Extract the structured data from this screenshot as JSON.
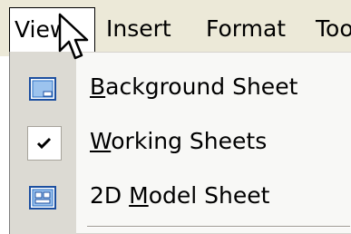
{
  "menubar": {
    "items": [
      {
        "label": "View"
      },
      {
        "label": "Insert"
      },
      {
        "label": "Format"
      },
      {
        "label": "Too"
      }
    ]
  },
  "dropdown": {
    "items": [
      {
        "pre": "",
        "ul": "B",
        "post": "ackground Sheet",
        "icon": "background-sheet-icon"
      },
      {
        "pre": "",
        "ul": "W",
        "post": "orking Sheets",
        "icon": "check-icon",
        "checked": true
      },
      {
        "pre": "2D ",
        "ul": "M",
        "post": "odel Sheet",
        "icon": "model-sheet-icon"
      }
    ]
  },
  "colors": {
    "menubar_bg": "#ece9d8",
    "icon_strip": "#dcdad3",
    "menu_bg": "#f8f8f6",
    "icon_blue": "#2a6fc6"
  }
}
